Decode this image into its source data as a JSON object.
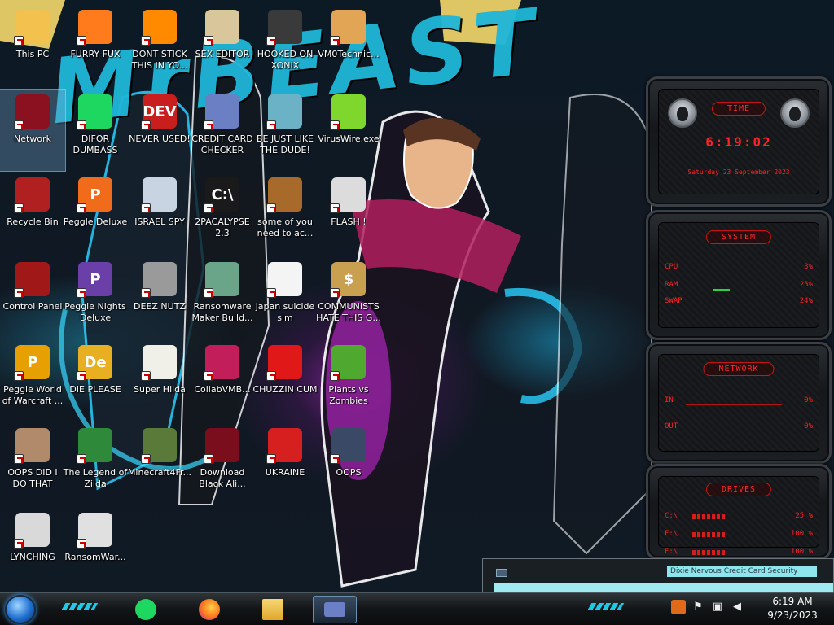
{
  "wallpaper": {
    "title": "MrBEAST"
  },
  "desktop_icons": [
    {
      "label": "This PC",
      "icon": "this-pc-icon",
      "color": "#f2c14e"
    },
    {
      "label": "FURRY FUX",
      "icon": "firefox-icon",
      "color": "#ff7b1c"
    },
    {
      "label": "DONT STICK THIS IN YO...",
      "icon": "vlc-cone-icon",
      "color": "#ff8a00"
    },
    {
      "label": "SEX EDITOR",
      "icon": "hxd-icon",
      "color": "#d9c69a"
    },
    {
      "label": "HOOKED ON XONIX",
      "icon": "xonix-icon",
      "color": "#3a3a3a"
    },
    {
      "label": "VM0Technic...",
      "icon": "technician-icon",
      "color": "#e2a455"
    },
    {
      "label": "Network",
      "icon": "black-alien-icon",
      "color": "#8b1020"
    },
    {
      "label": "DIFOR DUMBASS",
      "icon": "spotify-icon",
      "color": "#1ed760"
    },
    {
      "label": "NEVER USED!",
      "icon": "dev-icon",
      "color": "#c81e1e",
      "text": "DEV"
    },
    {
      "label": "CREDIT CARD CHECKER",
      "icon": "credit-card-icon",
      "color": "#6b7fc4"
    },
    {
      "label": "BE JUST LIKE THE DUDE!",
      "icon": "dude-icon",
      "color": "#6bb2c7"
    },
    {
      "label": "VirusWire.exe",
      "icon": "lime-icon",
      "color": "#7fd62c"
    },
    {
      "label": "Recycle Bin",
      "icon": "recycle-bin-icon",
      "color": "#b02020"
    },
    {
      "label": "Peggle Deluxe",
      "icon": "peggle-icon",
      "color": "#f06b1a",
      "text": "P"
    },
    {
      "label": "ISRAEL SPY",
      "icon": "spy-icon",
      "color": "#c9d4e2"
    },
    {
      "label": "2PACALYPSE 2.3",
      "icon": "terminal-icon",
      "color": "#1a1a1a",
      "text": "C:\\"
    },
    {
      "label": "some of you need to ac...",
      "icon": "dog-icon",
      "color": "#a86a2a"
    },
    {
      "label": "FLASH !",
      "icon": "flash-icon",
      "color": "#dcdcdc"
    },
    {
      "label": "Control Panel",
      "icon": "control-panel-icon",
      "color": "#a01818"
    },
    {
      "label": "Peggle Nights Deluxe",
      "icon": "peggle-nights-icon",
      "color": "#6b3fa8",
      "text": "P"
    },
    {
      "label": "DEEZ NUTZ",
      "icon": "windows-stack-icon",
      "color": "#9a9a9a"
    },
    {
      "label": "Ransomware Maker Build...",
      "icon": "ransomware-builder-icon",
      "color": "#6aa58a"
    },
    {
      "label": "japan suicide sim",
      "icon": "document-icon",
      "color": "#f4f4f4"
    },
    {
      "label": "COMMUNISTS HATE THIS G...",
      "icon": "money-bag-icon",
      "color": "#c8a050",
      "text": "$"
    },
    {
      "label": "Peggle World of Warcraft ...",
      "icon": "peggle-wow-icon",
      "color": "#e6a000",
      "text": "P"
    },
    {
      "label": "DIE PLEASE",
      "icon": "de-icon",
      "color": "#e8b020",
      "text": "De"
    },
    {
      "label": "Super Hilda",
      "icon": "hilda-icon",
      "color": "#f0f0e8"
    },
    {
      "label": "CollabVMB...",
      "icon": "collabvm-icon",
      "color": "#c21e5a"
    },
    {
      "label": "CHUZZIN CUM",
      "icon": "chuzzle-icon",
      "color": "#e01818"
    },
    {
      "label": "Plants vs Zombies",
      "icon": "plants-vs-zombies-icon",
      "color": "#4fa830"
    },
    {
      "label": "OOPS DID I DO THAT",
      "icon": "portrait-icon",
      "color": "#b08a6a"
    },
    {
      "label": "The Legend of Zilda",
      "icon": "zelda-icon",
      "color": "#2e8a3a"
    },
    {
      "label": "Minecraft4Fr...",
      "icon": "minecraft-icon",
      "color": "#5a7a3a"
    },
    {
      "label": "Download Black Ali...",
      "icon": "black-alien-download-icon",
      "color": "#7a0e1c"
    },
    {
      "label": "UKRAINE",
      "icon": "radiation-icon",
      "color": "#d62020"
    },
    {
      "label": "OOPS",
      "icon": "monitor-icon",
      "color": "#3a4a66"
    },
    {
      "label": "LYNCHING",
      "icon": "noose-icon",
      "color": "#d9d9d9"
    },
    {
      "label": "RansomWar...",
      "icon": "skull-icon",
      "color": "#e0e0e0"
    }
  ],
  "gadgets": {
    "time": {
      "title": "TIME",
      "clock": "6:19:02",
      "date": "Saturday 23 September 2023"
    },
    "system": {
      "title": "SYSTEM",
      "rows": [
        {
          "label": "CPU",
          "value": "3%"
        },
        {
          "label": "RAM",
          "value": "25%"
        },
        {
          "label": "SWAP",
          "value": "24%"
        }
      ]
    },
    "network": {
      "title": "NETWORK",
      "rows": [
        {
          "label": "IN",
          "value": "0%"
        },
        {
          "label": "OUT",
          "value": "0%"
        }
      ]
    },
    "drives": {
      "title": "DRIVES",
      "rows": [
        {
          "label": "C:\\",
          "value": "25 %"
        },
        {
          "label": "F:\\",
          "value": "100 %"
        },
        {
          "label": "E:\\",
          "value": "100 %"
        }
      ]
    }
  },
  "notification_window": {
    "text": "Dixie Nervous Credit Card Security"
  },
  "taskbar": {
    "apps": [
      {
        "name": "spotify-task",
        "color": "#1ed760"
      },
      {
        "name": "firefox-task",
        "color": "#ff7b1c"
      },
      {
        "name": "file-explorer-task",
        "color": "#f2c14e"
      },
      {
        "name": "credit-card-checker-task",
        "color": "#6b7fc4"
      }
    ],
    "clock_time": "6:19 AM",
    "clock_date": "9/23/2023"
  }
}
